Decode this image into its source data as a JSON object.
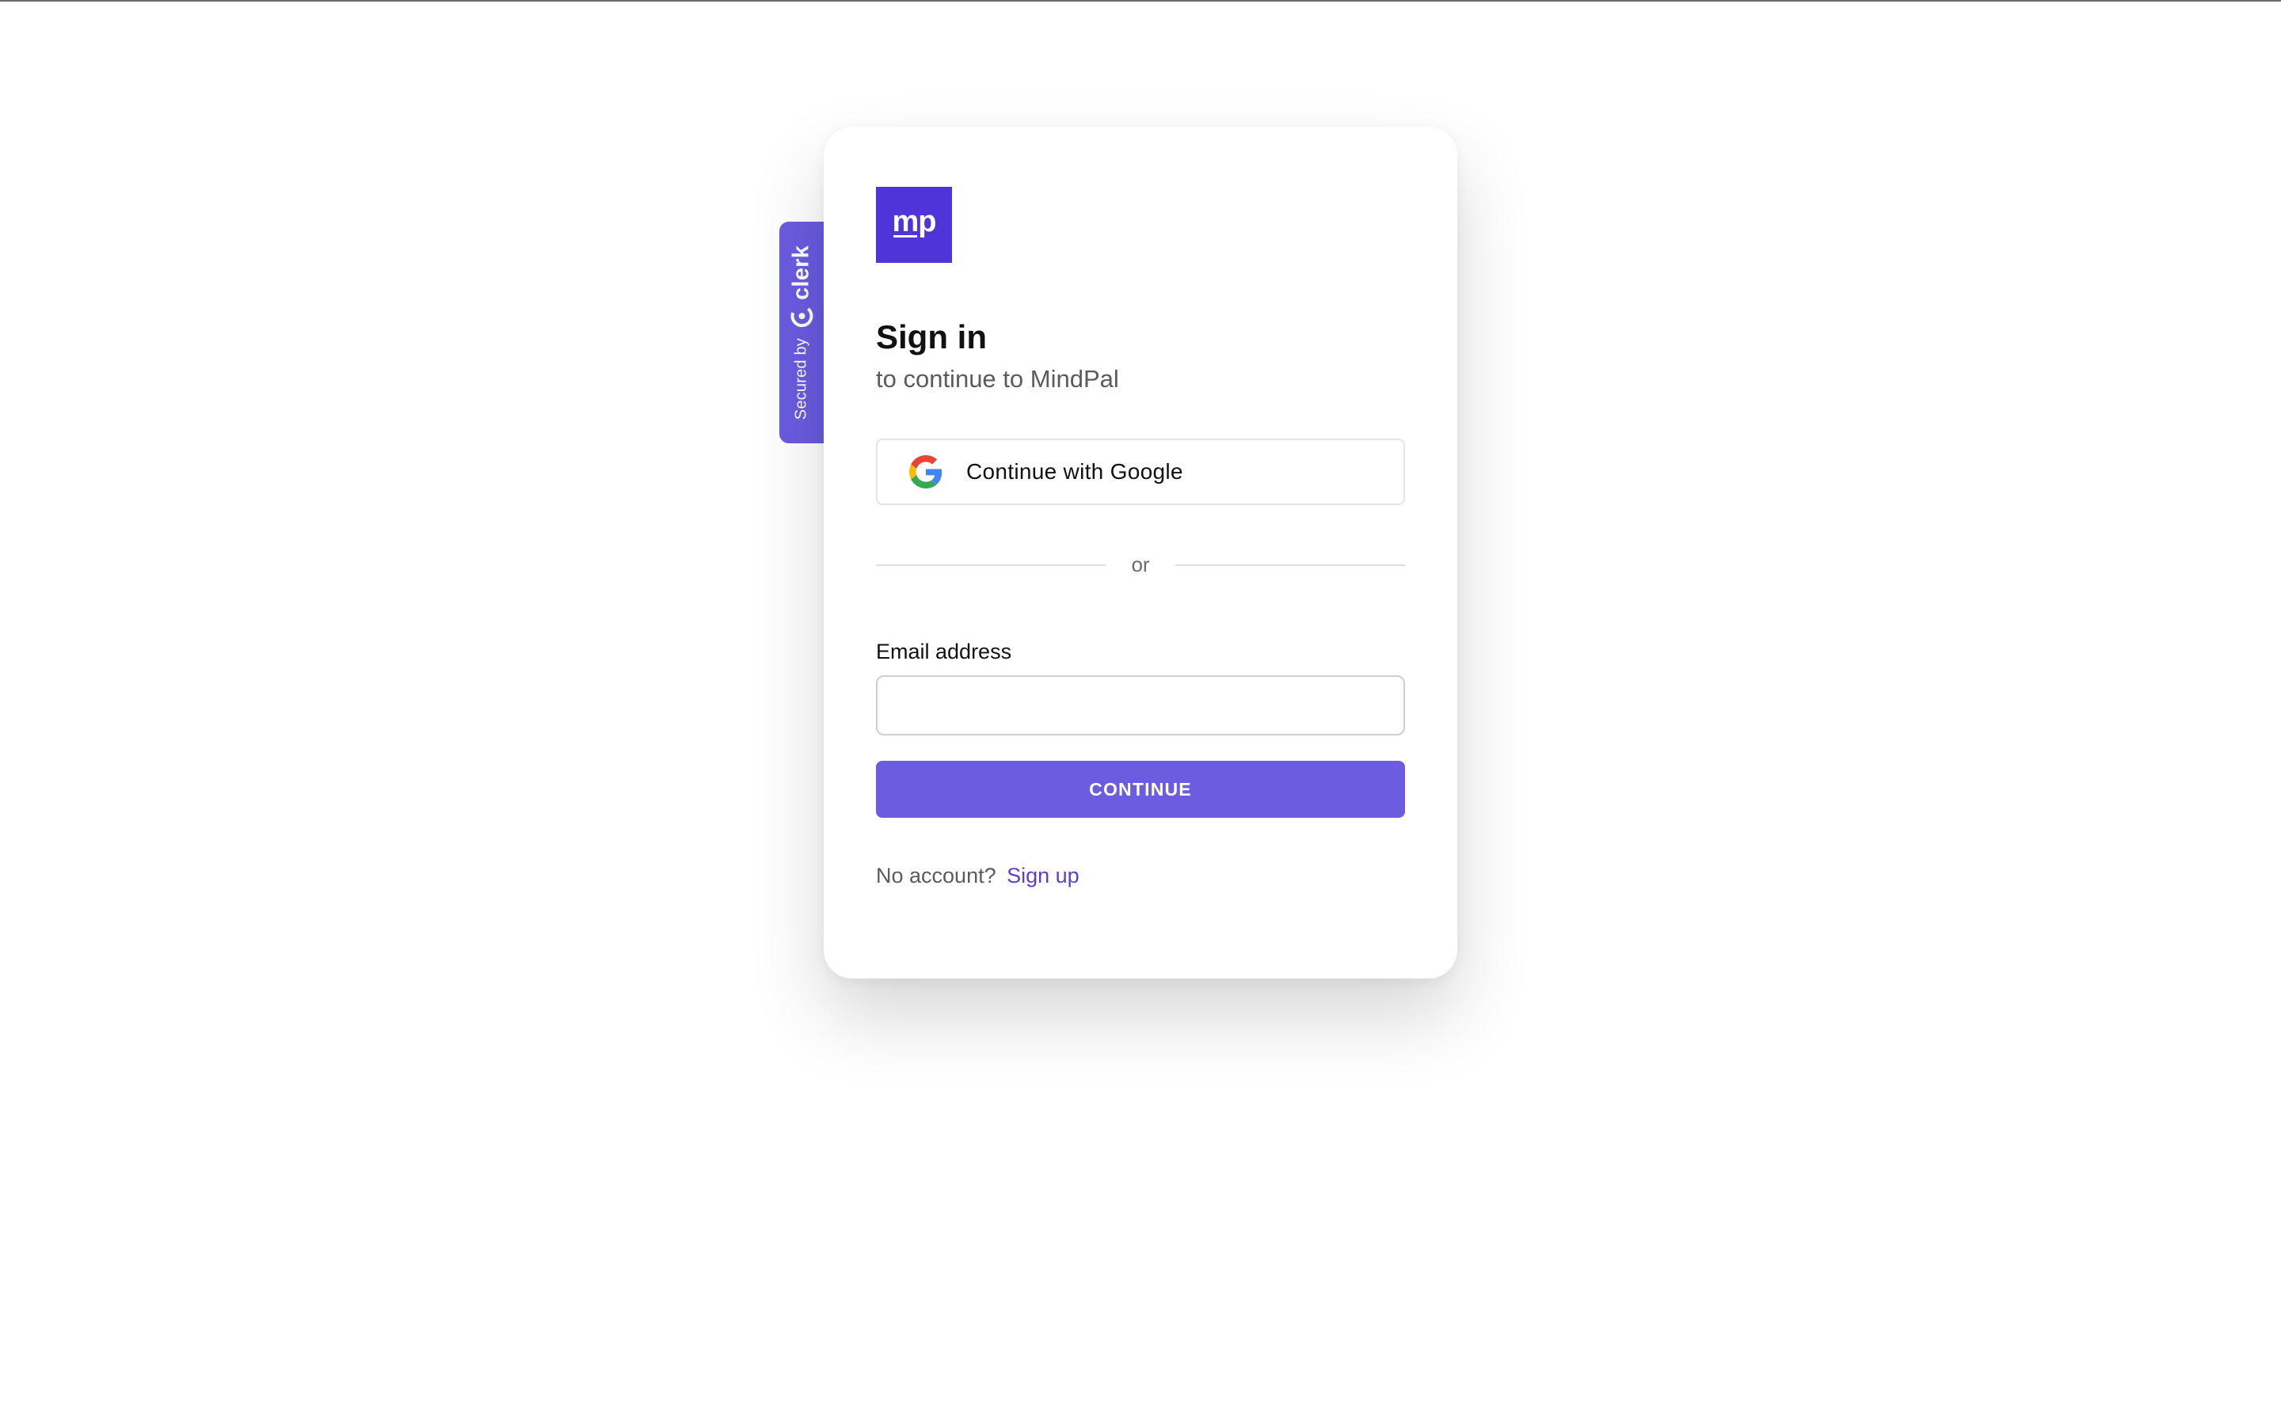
{
  "brand": {
    "logo_text": "mp",
    "accent_color": "#4e34d9",
    "button_color": "#6b5ce0",
    "link_color": "#5a3ed6"
  },
  "secured_badge": {
    "prefix": "Secured by",
    "provider": "clerk",
    "icon": "clerk-icon"
  },
  "signin": {
    "title": "Sign in",
    "subtitle": "to continue to MindPal",
    "google_button_label": "Continue with Google",
    "google_icon": "google-icon",
    "divider_text": "or",
    "email_label": "Email address",
    "email_value": "",
    "continue_label": "CONTINUE",
    "no_account_text": "No account?",
    "signup_link": "Sign up"
  }
}
